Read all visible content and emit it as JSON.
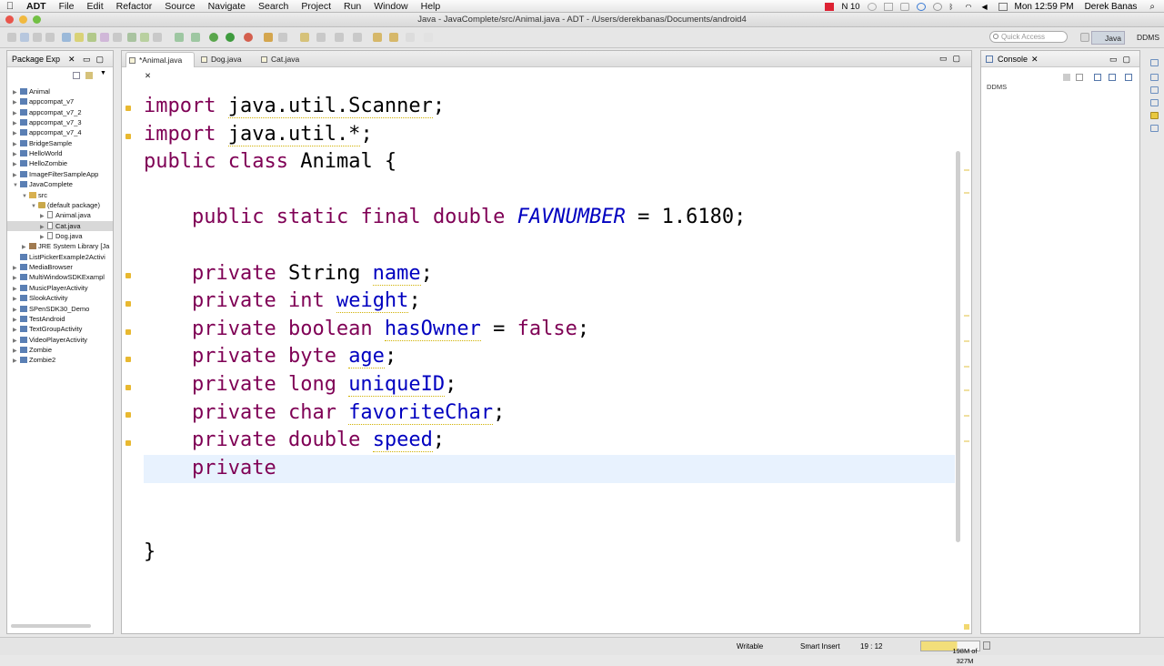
{
  "menubar": {
    "app_name": "ADT",
    "menus": [
      "File",
      "Edit",
      "Refactor",
      "Source",
      "Navigate",
      "Search",
      "Project",
      "Run",
      "Window",
      "Help"
    ],
    "badge_count": "10",
    "clock": "Mon 12:59 PM",
    "user": "Derek Banas"
  },
  "window": {
    "title": "Java - JavaComplete/src/Animal.java - ADT - /Users/derekbanas/Documents/android4"
  },
  "toolbar": {
    "quick_access_placeholder": "Quick Access",
    "perspectives": [
      "Java",
      "DDMS"
    ]
  },
  "package_explorer": {
    "title": "Package Exp",
    "items": [
      {
        "label": "Animal",
        "indent": 0,
        "toggle": "▶",
        "icon": "project"
      },
      {
        "label": "appcompat_v7",
        "indent": 0,
        "toggle": "▶",
        "icon": "project"
      },
      {
        "label": "appcompat_v7_2",
        "indent": 0,
        "toggle": "▶",
        "icon": "project"
      },
      {
        "label": "appcompat_v7_3",
        "indent": 0,
        "toggle": "▶",
        "icon": "project"
      },
      {
        "label": "appcompat_v7_4",
        "indent": 0,
        "toggle": "▶",
        "icon": "project"
      },
      {
        "label": "BridgeSample",
        "indent": 0,
        "toggle": "▶",
        "icon": "project"
      },
      {
        "label": "HelloWorld",
        "indent": 0,
        "toggle": "▶",
        "icon": "project"
      },
      {
        "label": "HelloZombie",
        "indent": 0,
        "toggle": "▶",
        "icon": "project"
      },
      {
        "label": "ImageFilterSampleApp",
        "indent": 0,
        "toggle": "▶",
        "icon": "project"
      },
      {
        "label": "JavaComplete",
        "indent": 0,
        "toggle": "▼",
        "icon": "project"
      },
      {
        "label": "src",
        "indent": 1,
        "toggle": "▼",
        "icon": "folder"
      },
      {
        "label": "(default package)",
        "indent": 2,
        "toggle": "▼",
        "icon": "package"
      },
      {
        "label": "Animal.java",
        "indent": 3,
        "toggle": "▶",
        "icon": "file"
      },
      {
        "label": "Cat.java",
        "indent": 3,
        "toggle": "▶",
        "icon": "file",
        "selected": true
      },
      {
        "label": "Dog.java",
        "indent": 3,
        "toggle": "▶",
        "icon": "file"
      },
      {
        "label": "JRE System Library [Ja",
        "indent": 1,
        "toggle": "▶",
        "icon": "library"
      },
      {
        "label": "ListPickerExample2Activi",
        "indent": 0,
        "toggle": "",
        "icon": "project"
      },
      {
        "label": "MediaBrowser",
        "indent": 0,
        "toggle": "▶",
        "icon": "project"
      },
      {
        "label": "MultiWindowSDKExampl",
        "indent": 0,
        "toggle": "▶",
        "icon": "project"
      },
      {
        "label": "MusicPlayerActivity",
        "indent": 0,
        "toggle": "▶",
        "icon": "project"
      },
      {
        "label": "SlookActivity",
        "indent": 0,
        "toggle": "▶",
        "icon": "project"
      },
      {
        "label": "SPenSDK30_Demo",
        "indent": 0,
        "toggle": "▶",
        "icon": "project"
      },
      {
        "label": "TestAndroid",
        "indent": 0,
        "toggle": "▶",
        "icon": "project"
      },
      {
        "label": "TextGroupActivity",
        "indent": 0,
        "toggle": "▶",
        "icon": "project"
      },
      {
        "label": "VideoPlayerActivity",
        "indent": 0,
        "toggle": "▶",
        "icon": "project"
      },
      {
        "label": "Zombie",
        "indent": 0,
        "toggle": "▶",
        "icon": "project"
      },
      {
        "label": "Zombie2",
        "indent": 0,
        "toggle": "▶",
        "icon": "project"
      }
    ]
  },
  "editor": {
    "tabs": [
      {
        "label": "*Animal.java",
        "active": true
      },
      {
        "label": "Dog.java",
        "active": false
      },
      {
        "label": "Cat.java",
        "active": false
      }
    ],
    "lines": [
      [
        {
          "t": "import",
          "c": "kw"
        },
        {
          "t": " "
        },
        {
          "t": "java.util.Scanner",
          "c": "sq"
        },
        {
          "t": ";"
        }
      ],
      [
        {
          "t": "import",
          "c": "kw"
        },
        {
          "t": " "
        },
        {
          "t": "java.util.*",
          "c": "sq"
        },
        {
          "t": ";"
        }
      ],
      [
        {
          "t": "public",
          "c": "kw"
        },
        {
          "t": " "
        },
        {
          "t": "class",
          "c": "kw"
        },
        {
          "t": " Animal {"
        }
      ],
      [],
      [
        {
          "t": "    "
        },
        {
          "t": "public",
          "c": "kw"
        },
        {
          "t": " "
        },
        {
          "t": "static",
          "c": "kw"
        },
        {
          "t": " "
        },
        {
          "t": "final",
          "c": "kw"
        },
        {
          "t": " "
        },
        {
          "t": "double",
          "c": "kw"
        },
        {
          "t": " "
        },
        {
          "t": "FAVNUMBER",
          "c": "cst"
        },
        {
          "t": " = 1.6180;"
        }
      ],
      [],
      [
        {
          "t": "    "
        },
        {
          "t": "private",
          "c": "kw"
        },
        {
          "t": " String "
        },
        {
          "t": "name",
          "c": "fld sq"
        },
        {
          "t": ";"
        }
      ],
      [
        {
          "t": "    "
        },
        {
          "t": "private",
          "c": "kw"
        },
        {
          "t": " "
        },
        {
          "t": "int",
          "c": "kw"
        },
        {
          "t": " "
        },
        {
          "t": "weight",
          "c": "fld sq"
        },
        {
          "t": ";"
        }
      ],
      [
        {
          "t": "    "
        },
        {
          "t": "private",
          "c": "kw"
        },
        {
          "t": " "
        },
        {
          "t": "boolean",
          "c": "kw"
        },
        {
          "t": " "
        },
        {
          "t": "hasOwner",
          "c": "fld sq"
        },
        {
          "t": " = "
        },
        {
          "t": "false",
          "c": "kw"
        },
        {
          "t": ";"
        }
      ],
      [
        {
          "t": "    "
        },
        {
          "t": "private",
          "c": "kw"
        },
        {
          "t": " "
        },
        {
          "t": "byte",
          "c": "kw"
        },
        {
          "t": " "
        },
        {
          "t": "age",
          "c": "fld sq"
        },
        {
          "t": ";"
        }
      ],
      [
        {
          "t": "    "
        },
        {
          "t": "private",
          "c": "kw"
        },
        {
          "t": " "
        },
        {
          "t": "long",
          "c": "kw"
        },
        {
          "t": " "
        },
        {
          "t": "uniqueID",
          "c": "fld sq"
        },
        {
          "t": ";"
        }
      ],
      [
        {
          "t": "    "
        },
        {
          "t": "private",
          "c": "kw"
        },
        {
          "t": " "
        },
        {
          "t": "char",
          "c": "kw"
        },
        {
          "t": " "
        },
        {
          "t": "favoriteChar",
          "c": "fld sq"
        },
        {
          "t": ";"
        }
      ],
      [
        {
          "t": "    "
        },
        {
          "t": "private",
          "c": "kw"
        },
        {
          "t": " "
        },
        {
          "t": "double",
          "c": "kw"
        },
        {
          "t": " "
        },
        {
          "t": "speed",
          "c": "fld sq"
        },
        {
          "t": ";"
        }
      ],
      [
        {
          "t": "    "
        },
        {
          "t": "private",
          "c": "kw"
        }
      ],
      [],
      [],
      [
        {
          "t": "}"
        }
      ]
    ]
  },
  "console": {
    "title": "Console",
    "label": "DDMS"
  },
  "status": {
    "writable": "Writable",
    "insert_mode": "Smart Insert",
    "position": "19 : 12",
    "heap": "198M of 327M",
    "heap_used_fraction": 0.61
  },
  "colors": {
    "keyword": "#7f0055",
    "field": "#0000c0",
    "current_line": "#e8f2fe",
    "warning": "#e8b830"
  }
}
